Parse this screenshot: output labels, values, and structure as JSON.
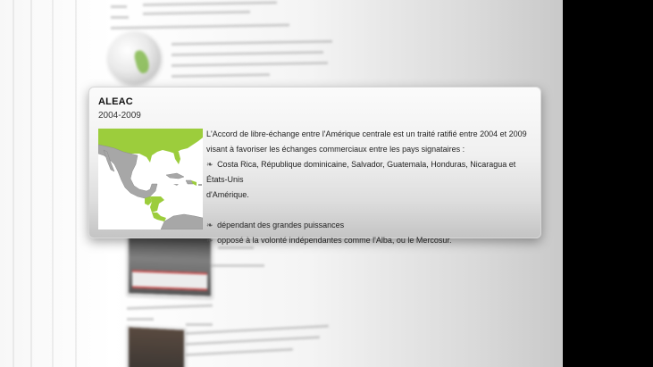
{
  "popup": {
    "title": "ALEAC",
    "date": "2004-2009",
    "description_lines": [
      "L'Accord de libre-échange entre l'Amérique centrale est un traité ratifié entre 2004 et 2009",
      "visant à favoriser les échanges commerciaux entre les pays signataires :"
    ],
    "bullet_symbol": "❧",
    "countries_bullet": "Costa Rica, République dominicaine, Salvador, Guatemala, Honduras, Nicaragua et États-Unis",
    "countries_continuation": "d'Amérique.",
    "bullets": [
      "dépendant des grandes puissances",
      "opposé à la volonté indépendantes comme l'Alba, ou le Mercosur."
    ],
    "map_icon": "central-america-map-icon"
  },
  "colors": {
    "map_highlight": "#9ccd3c",
    "map_land": "#a7a7a7",
    "map_water": "#ffffff",
    "page_background": "#000000"
  }
}
